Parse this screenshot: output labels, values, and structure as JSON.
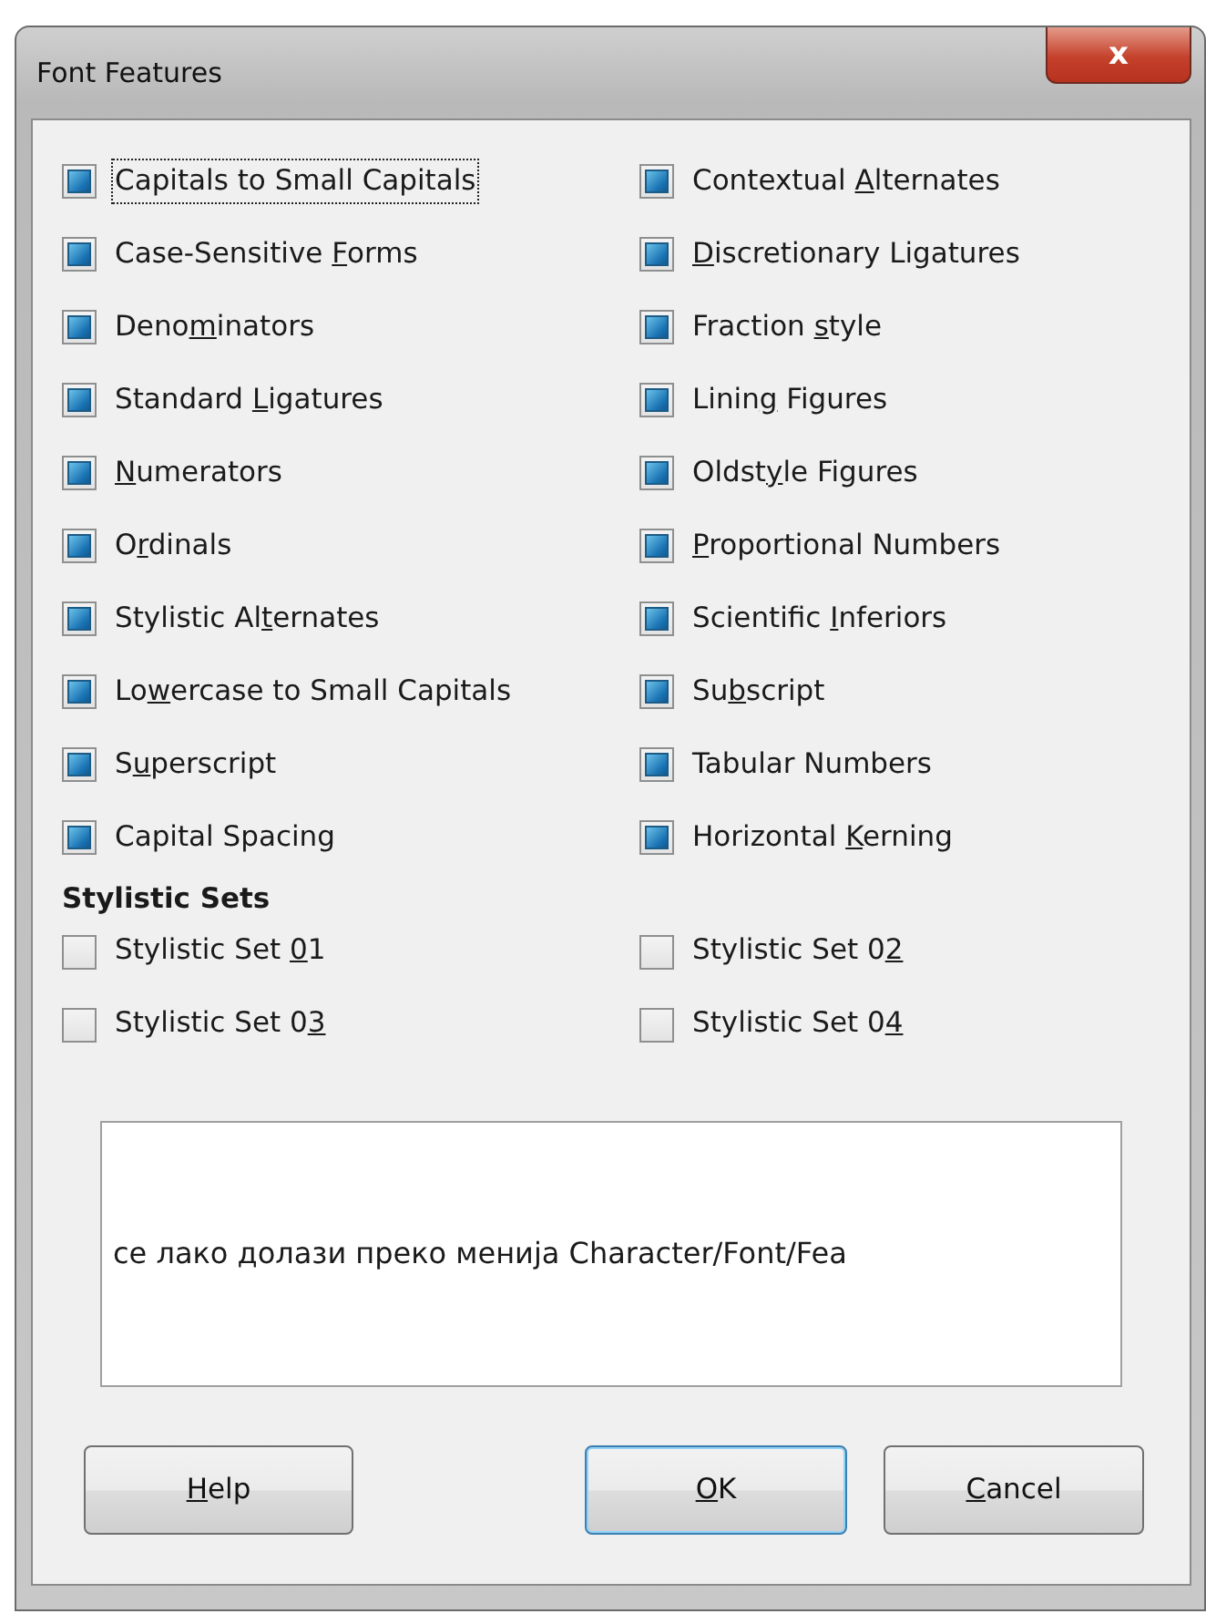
{
  "window": {
    "title": "Font Features",
    "close_glyph": "x"
  },
  "features": [
    {
      "label": {
        "before": "Capitals to Small Capitals"
      },
      "indeterminate": true,
      "focused": true
    },
    {
      "label": {
        "before": "Contextual ",
        "key": "A",
        "after": "lternates"
      },
      "indeterminate": true,
      "focused": false
    },
    {
      "label": {
        "before": "Case-Sensitive ",
        "key": "F",
        "after": "orms"
      },
      "indeterminate": true,
      "focused": false
    },
    {
      "label": {
        "key": "D",
        "after": "iscretionary Ligatures"
      },
      "indeterminate": true,
      "focused": false
    },
    {
      "label": {
        "before": "Deno",
        "key": "m",
        "after": "inators"
      },
      "indeterminate": true,
      "focused": false
    },
    {
      "label": {
        "before": "Fraction ",
        "key": "s",
        "after": "tyle"
      },
      "indeterminate": true,
      "focused": false
    },
    {
      "label": {
        "before": "Standard ",
        "key": "L",
        "after": "igatures"
      },
      "indeterminate": true,
      "focused": false
    },
    {
      "label": {
        "before": "Linin",
        "key": "g",
        "after": " Figures"
      },
      "indeterminate": true,
      "focused": false
    },
    {
      "label": {
        "key": "N",
        "after": "umerators"
      },
      "indeterminate": true,
      "focused": false
    },
    {
      "label": {
        "before": "Oldst",
        "key": "y",
        "after": "le Figures"
      },
      "indeterminate": true,
      "focused": false
    },
    {
      "label": {
        "before": "O",
        "key": "r",
        "after": "dinals"
      },
      "indeterminate": true,
      "focused": false
    },
    {
      "label": {
        "key": "P",
        "after": "roportional Numbers"
      },
      "indeterminate": true,
      "focused": false
    },
    {
      "label": {
        "before": "Stylistic Al",
        "key": "t",
        "after": "ernates"
      },
      "indeterminate": true,
      "focused": false
    },
    {
      "label": {
        "before": "Scientific ",
        "key": "I",
        "after": "nferiors"
      },
      "indeterminate": true,
      "focused": false
    },
    {
      "label": {
        "before": "Lo",
        "key": "w",
        "after": "ercase to Small Capitals"
      },
      "indeterminate": true,
      "focused": false
    },
    {
      "label": {
        "before": "Su",
        "key": "b",
        "after": "script"
      },
      "indeterminate": true,
      "focused": false
    },
    {
      "label": {
        "before": "S",
        "key": "u",
        "after": "perscript"
      },
      "indeterminate": true,
      "focused": false
    },
    {
      "label": {
        "before": "Tabular Numbers"
      },
      "indeterminate": true,
      "focused": false
    },
    {
      "label": {
        "before": "Capital Spacing"
      },
      "indeterminate": true,
      "focused": false
    },
    {
      "label": {
        "before": "Horizontal ",
        "key": "K",
        "after": "erning"
      },
      "indeterminate": true,
      "focused": false
    }
  ],
  "stylistic_sets": {
    "heading": "Stylistic Sets",
    "items": [
      {
        "label": {
          "before": "Stylistic Set ",
          "key": "0",
          "after": "1"
        },
        "indeterminate": false,
        "focused": false
      },
      {
        "label": {
          "before": "Stylistic Set 0",
          "key": "2"
        },
        "indeterminate": false,
        "focused": false
      },
      {
        "label": {
          "before": "Stylistic Set 0",
          "key": "3"
        },
        "indeterminate": false,
        "focused": false
      },
      {
        "label": {
          "before": "Stylistic Set 0",
          "key": "4"
        },
        "indeterminate": false,
        "focused": false
      }
    ]
  },
  "preview": {
    "text": "се лако долази преко менија Character/Font/Fea"
  },
  "buttons": [
    {
      "label": {
        "key": "H",
        "after": "elp"
      },
      "default": false
    },
    {
      "label": {
        "key": "O",
        "after": "K"
      },
      "default": true
    },
    {
      "label": {
        "key": "C",
        "after": "ancel"
      },
      "default": false
    }
  ]
}
